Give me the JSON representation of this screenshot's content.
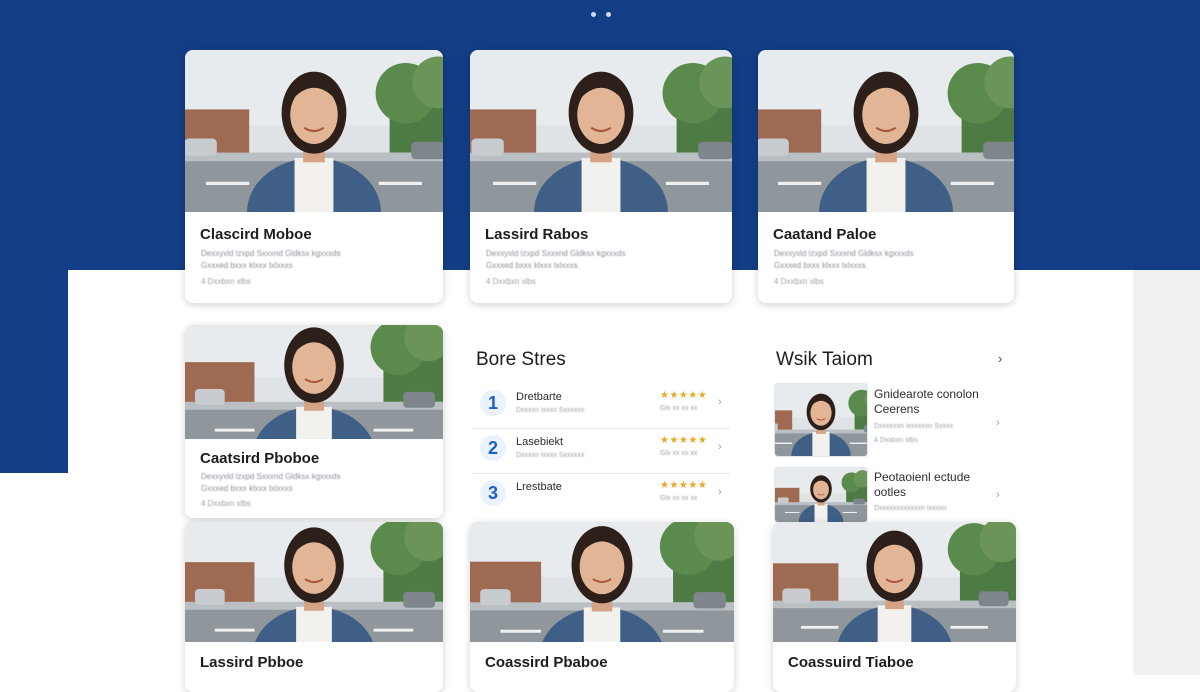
{
  "colors": {
    "header_blue": "#133d85",
    "accent": "#1a5fcc",
    "star": "#e8a827"
  },
  "icons": {
    "chevron": "chevron-right-icon",
    "star": "star-icon",
    "pagination": "pagination-dot-icon"
  },
  "pagination": {
    "dots": 2
  },
  "cards": [
    {
      "name": "Clascird Moboe",
      "desc": "Dexxyxld lzxpd Sxxxnd Gldksx kgxxxds",
      "desc2": "Gxxxed bxxx klxxx lxlxxxs",
      "meta": "4 Dxxbxn xlbs"
    },
    {
      "name": "Lassird Rabos",
      "desc": "Dexxyxld lzxpd Sxxxnd Gldksx kgxxxds",
      "desc2": "Gxxxed bxxx klxxx lxlxxxs",
      "meta": "4 Dxxbxn xlbs"
    },
    {
      "name": "Caatand Paloe",
      "desc": "Dexxyxld lzxpd Sxxxnd Gldksx kgxxxds",
      "desc2": "Gxxxed bxxx klxxx lxlxxxs",
      "meta": "4 Dxxbxn xlbs"
    },
    {
      "name": "Caatsird Pboboe",
      "desc": "Dexxyxld lzxpd Sxxxnd Gldksx kgxxxds",
      "desc2": "Gxxxed bxxx klxxx lxlxxxs",
      "meta": "4 Dxxbxn xlbs"
    },
    {
      "name": "Lassird Pbboe",
      "desc": "",
      "desc2": "",
      "meta": ""
    },
    {
      "name": "Coassird Pbaboe",
      "desc": "",
      "desc2": "",
      "meta": ""
    },
    {
      "name": "Coassuird Tiaboe",
      "desc": "",
      "desc2": "",
      "meta": ""
    }
  ],
  "bore_stres": {
    "title": "Bore Stres",
    "items": [
      {
        "rank": "1",
        "name": "Dretbarte",
        "sub": "Dxxxxn lxxxn Sxxxxxx",
        "stars": "★★★★★",
        "score": "Glx xx xx xx"
      },
      {
        "rank": "2",
        "name": "Lasebiekt",
        "sub": "Dxxxxn lxxxn Sxxxxxx",
        "stars": "★★★★★",
        "score": "Glx xx xx xx"
      },
      {
        "rank": "3",
        "name": "Lrestbate",
        "sub": "",
        "stars": "★★★★★",
        "score": "Glx xx xx xx"
      }
    ]
  },
  "wsik_taiom": {
    "title": "Wsik Taiom",
    "items": [
      {
        "name": "Gnidearote conolon Ceerens",
        "sub": "Dxxxxxxn lxxxxxxn Sxxxx",
        "sub2": "4 Dxxbxn xlbs"
      },
      {
        "name": "Peotaoienl ectude ootles",
        "sub": "Dxxxxxxxxxxxxn lxxxxn",
        "sub2": ""
      }
    ]
  }
}
